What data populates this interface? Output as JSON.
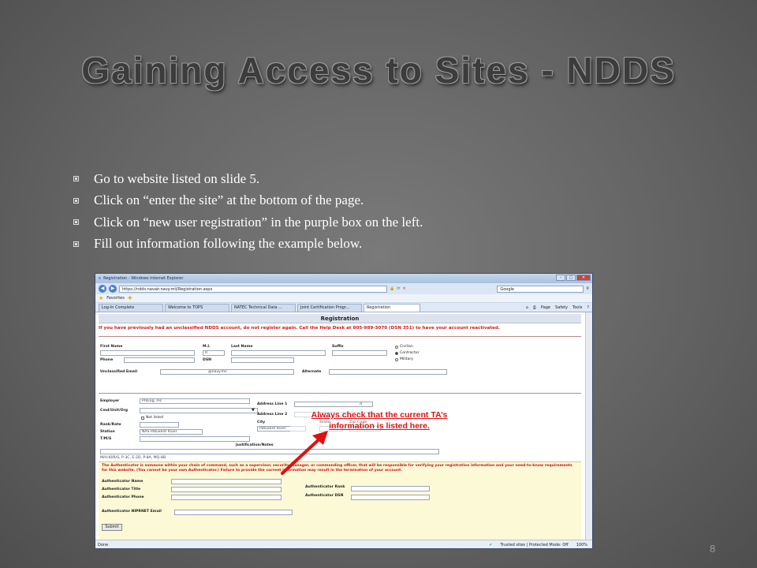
{
  "slide": {
    "title": "Gaining Access to Sites - NDDS",
    "page_number": "8",
    "bullets": [
      "Go to website listed on slide 5.",
      "Click on “enter the site” at the bottom of the page.",
      "Click on “new user registration” in the purple box on the left.",
      "Fill out information following the example below."
    ]
  },
  "browser": {
    "title": "Registration - Windows Internet Explorer",
    "url": "https://ndds.navair.navy.mil/Registration.aspx",
    "search_placeholder": "Google",
    "favorites_label": "Favorites",
    "tabs": [
      "Log-In Complete",
      "Welcome to TOPS",
      "NATEC Technical Data ...",
      "Joint Certification Progr...",
      "Registration"
    ],
    "tools": [
      "Page",
      "Safety",
      "Tools"
    ],
    "status_left": "Done",
    "status_right": "Trusted sites | Protected Mode: Off",
    "zoom": "100%"
  },
  "form": {
    "header": "Registration",
    "warning": "If you have previously had an unclassified NDDS account, do not register again. Call the Help Desk at 805-989-3070 (DSN 351) to have your account reactivated.",
    "labels": {
      "first_name": "First Name",
      "mi": "M.I.",
      "last_name": "Last Name",
      "suffix": "Suffix",
      "phone": "Phone",
      "dsn": "DSN",
      "email": "Unclassified Email",
      "alternate": "Alternate",
      "employer": "Employer",
      "cmd": "Cmd/Unit/Org",
      "rank": "Rank/Rate",
      "station": "Station",
      "tms": "T/M/S",
      "addr1": "Address Line 1",
      "addr2": "Address Line 2",
      "city": "City",
      "state": "State",
      "zip": "Zip Code",
      "justification": "Justification/Notes"
    },
    "values": {
      "mi": "R",
      "email": "@navy.mil",
      "employer": "ProLog, Inc",
      "cmd_option": "Not listed",
      "station": "NAS Patuxent River",
      "city": "Patuxent River",
      "addr1_partial": "d",
      "justification": "M/H-60R/S, P-3C, E-2D, P-8A, MQ-8B"
    },
    "radios": {
      "civilian": "Civilian",
      "contractor": "Contractor",
      "military": "Military",
      "selected": "Contractor"
    },
    "authenticator_note": "The Authenticator is someone within your chain of command, such as a supervisor, security manager, or commanding officer, that will be responsible for verifying your registration information and your need-to-know requirements for this website. (You cannot be your own Authenticator.) Failure to provide the current information may result in the termination of your account.",
    "auth_labels": {
      "name": "Authenticator Name",
      "title": "Authenticator Title",
      "phone": "Authenticator Phone",
      "rank": "Authenticator Rank",
      "dsn": "Authenticator DSN",
      "email": "Authenticator NIPRNET Email"
    },
    "submit": "Submit"
  },
  "callout": {
    "line1": "Always check that the current TA’s",
    "line2": "information is listed here."
  },
  "colors": {
    "warning_red": "#d21a1a",
    "callout_red": "#e01010",
    "auth_background": "#fbf9d6"
  }
}
